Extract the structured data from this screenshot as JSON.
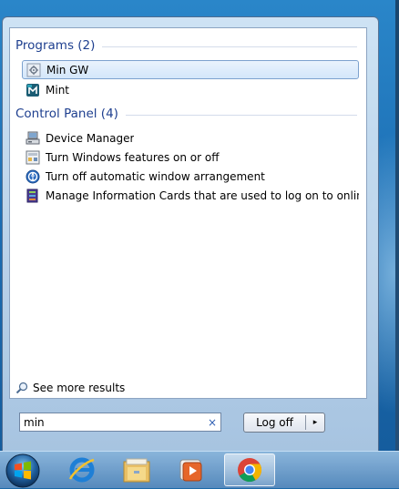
{
  "start_menu": {
    "programs_header": "Programs (2)",
    "programs": [
      {
        "label": "Min GW",
        "icon": "mingw-installer-icon",
        "selected": true
      },
      {
        "label": "Mint",
        "icon": "mint-icon",
        "selected": false
      }
    ],
    "control_panel_header": "Control Panel (4)",
    "control_panel": [
      {
        "label": "Device Manager",
        "icon": "device-manager-icon"
      },
      {
        "label": "Turn Windows features on or off",
        "icon": "windows-features-icon"
      },
      {
        "label": "Turn off automatic window arrangement",
        "icon": "ease-of-access-icon"
      },
      {
        "label": "Manage Information Cards that are used to log on to online ser...",
        "icon": "information-cards-icon"
      }
    ],
    "see_more": "See more results",
    "search": {
      "value": "min",
      "clear_glyph": "×"
    },
    "logoff": {
      "label": "Log off",
      "arrow": "▸"
    }
  },
  "taskbar": {
    "items": [
      "start-orb-icon",
      "internet-explorer-icon",
      "file-explorer-icon",
      "media-player-icon",
      "chrome-icon"
    ],
    "active": "chrome-icon"
  }
}
